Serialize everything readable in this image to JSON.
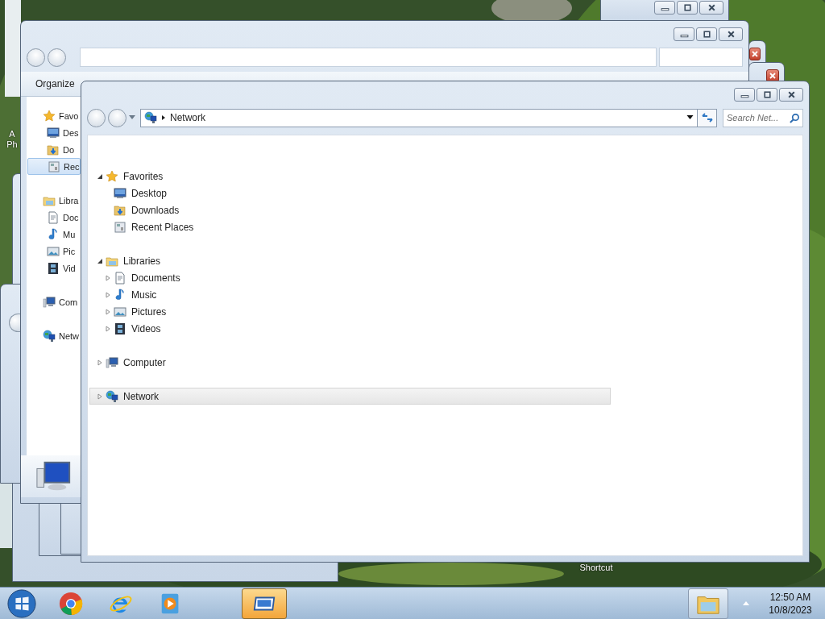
{
  "desktop": {
    "icon_labels": [
      {
        "lines": [
          "A",
          "Ph"
        ]
      },
      {
        "lines": [
          "Shortcut"
        ]
      }
    ]
  },
  "explorer_behind": {
    "toolbar": [
      "Organize"
    ],
    "nav_items": [
      {
        "label": "Favo",
        "kind": "favorites",
        "selected": false
      },
      {
        "label": "Des",
        "kind": "desktop",
        "selected": false
      },
      {
        "label": "Do",
        "kind": "downloads",
        "selected": false
      },
      {
        "label": "Rec",
        "kind": "recent",
        "selected": true
      },
      {
        "label": "Libra",
        "kind": "libraries",
        "selected": false
      },
      {
        "label": "Doc",
        "kind": "documents",
        "selected": false
      },
      {
        "label": "Mu",
        "kind": "music",
        "selected": false
      },
      {
        "label": "Pic",
        "kind": "pictures",
        "selected": false
      },
      {
        "label": "Vid",
        "kind": "videos",
        "selected": false
      },
      {
        "label": "Com",
        "kind": "computer",
        "selected": false
      },
      {
        "label": "Netw",
        "kind": "network",
        "selected": false
      }
    ]
  },
  "front_window": {
    "address": {
      "crumbs": [
        "Network"
      ]
    },
    "search": {
      "placeholder": "Search Net..."
    },
    "nav_tree": [
      {
        "label": "Favorites",
        "kind": "favorites",
        "expanded": true,
        "selected": false,
        "children": [
          {
            "label": "Desktop",
            "kind": "desktop",
            "selected": false
          },
          {
            "label": "Downloads",
            "kind": "downloads",
            "selected": false
          },
          {
            "label": "Recent Places",
            "kind": "recent",
            "selected": false
          }
        ]
      },
      {
        "label": "Libraries",
        "kind": "libraries",
        "expanded": true,
        "selected": false,
        "children": [
          {
            "label": "Documents",
            "kind": "documents",
            "expanded": false,
            "selected": false
          },
          {
            "label": "Music",
            "kind": "music",
            "expanded": false,
            "selected": false
          },
          {
            "label": "Pictures",
            "kind": "pictures",
            "expanded": false,
            "selected": false
          },
          {
            "label": "Videos",
            "kind": "videos",
            "expanded": false,
            "selected": false
          }
        ]
      },
      {
        "label": "Computer",
        "kind": "computer",
        "expanded": false,
        "selected": false
      },
      {
        "label": "Network",
        "kind": "network",
        "expanded": false,
        "selected": true
      }
    ]
  },
  "taskbar": {
    "apps": [
      {
        "kind": "round-browser",
        "active": false
      },
      {
        "kind": "e-browser",
        "active": false
      },
      {
        "kind": "media",
        "active": false
      },
      {
        "kind": "explorer",
        "active": true
      }
    ],
    "clock": {
      "time": "12:50 AM",
      "date": "10/8/2023"
    }
  }
}
